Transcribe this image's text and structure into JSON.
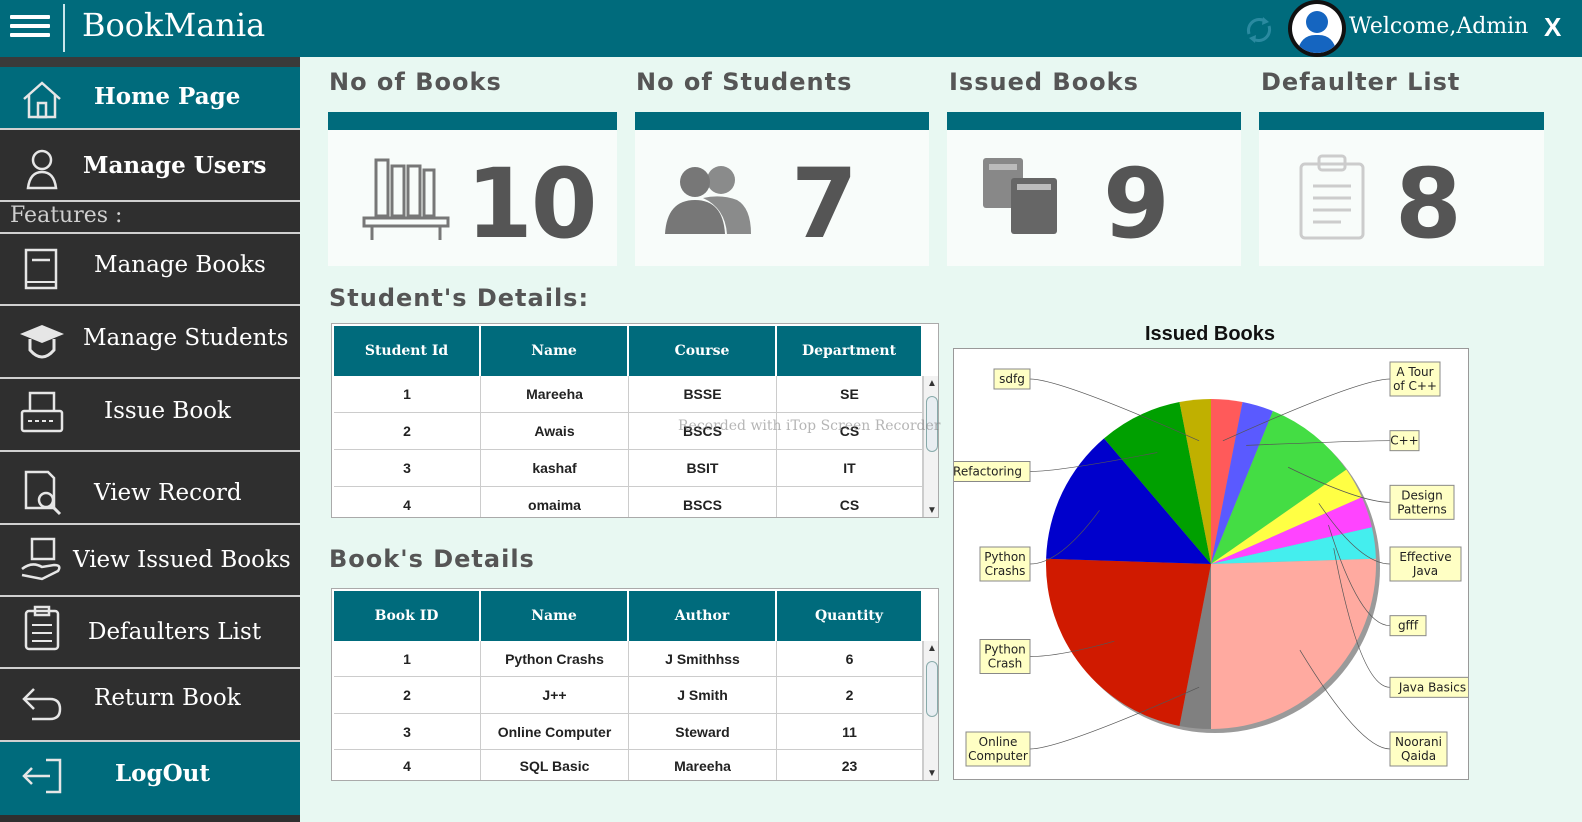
{
  "app": {
    "title": "BookMania",
    "welcome": "Welcome,Admin",
    "close": "X"
  },
  "sidebar": {
    "features_label": "Features  :",
    "items": [
      {
        "label": "Home Page",
        "icon": "home-icon"
      },
      {
        "label": "Manage Users",
        "icon": "user-icon"
      },
      {
        "label": "Manage Books",
        "icon": "book-icon"
      },
      {
        "label": "Manage Students",
        "icon": "graduation-cap-icon"
      },
      {
        "label": "Issue Book",
        "icon": "issue-icon"
      },
      {
        "label": "View Record",
        "icon": "document-search-icon"
      },
      {
        "label": "View Issued Books",
        "icon": "hand-book-icon"
      },
      {
        "label": "Defaulters List",
        "icon": "clipboard-icon"
      },
      {
        "label": "Return Book",
        "icon": "return-arrow-icon"
      },
      {
        "label": "LogOut",
        "icon": "logout-icon"
      }
    ]
  },
  "stats": [
    {
      "title": "No of Books",
      "value": "10",
      "icon": "bookshelf-icon"
    },
    {
      "title": "No of Students",
      "value": "7",
      "icon": "people-icon"
    },
    {
      "title": "Issued Books",
      "value": "9",
      "icon": "books-icon"
    },
    {
      "title": "Defaulter List",
      "value": "8",
      "icon": "clipboard-icon"
    }
  ],
  "students": {
    "title": "Student's Details:",
    "columns": [
      "Student Id",
      "Name",
      "Course",
      "Department"
    ],
    "rows": [
      [
        "1",
        "Mareeha",
        "BSSE",
        "SE"
      ],
      [
        "2",
        "Awais",
        "BSCS",
        "CS"
      ],
      [
        "3",
        "kashaf",
        "BSIT",
        "IT"
      ],
      [
        "4",
        "omaima",
        "BSCS",
        "CS"
      ]
    ]
  },
  "books": {
    "title": "Book's Details",
    "columns": [
      "Book ID",
      "Name",
      "Author",
      "Quantity"
    ],
    "rows": [
      [
        "1",
        "Python Crashs",
        "J Smithhss",
        "6"
      ],
      [
        "2",
        "J++",
        "J Smith",
        "2"
      ],
      [
        "3",
        "Online Computer",
        "Steward",
        "11"
      ],
      [
        "4",
        "SQL Basic",
        "Mareeha",
        "23"
      ]
    ]
  },
  "watermark": "Recorded with iTop Screen Recorder",
  "chart_data": {
    "type": "pie",
    "title": "Issued Books",
    "slices": [
      {
        "label": "A Tour of C++",
        "value": 3,
        "color": "#ff5a5a"
      },
      {
        "label": "C++",
        "value": 3,
        "color": "#5a5aff"
      },
      {
        "label": "Design Patterns",
        "value": 9,
        "color": "#44dd44"
      },
      {
        "label": "Effective Java",
        "value": 3,
        "color": "#ffff44"
      },
      {
        "label": "gfff",
        "value": 3,
        "color": "#ff44ff"
      },
      {
        "label": "Java Basics",
        "value": 3,
        "color": "#44eeee"
      },
      {
        "label": "Noorani Qaida",
        "value": 25,
        "color": "#ffaaa0"
      },
      {
        "label": "Online Computer",
        "value": 3,
        "color": "#808080"
      },
      {
        "label": "Python Crash",
        "value": 22,
        "color": "#d01a00"
      },
      {
        "label": "Python Crashs",
        "value": 13,
        "color": "#0000cc"
      },
      {
        "label": "Refactoring",
        "value": 8,
        "color": "#00a000"
      },
      {
        "label": "sdfg",
        "value": 3,
        "color": "#c0b000"
      }
    ]
  }
}
